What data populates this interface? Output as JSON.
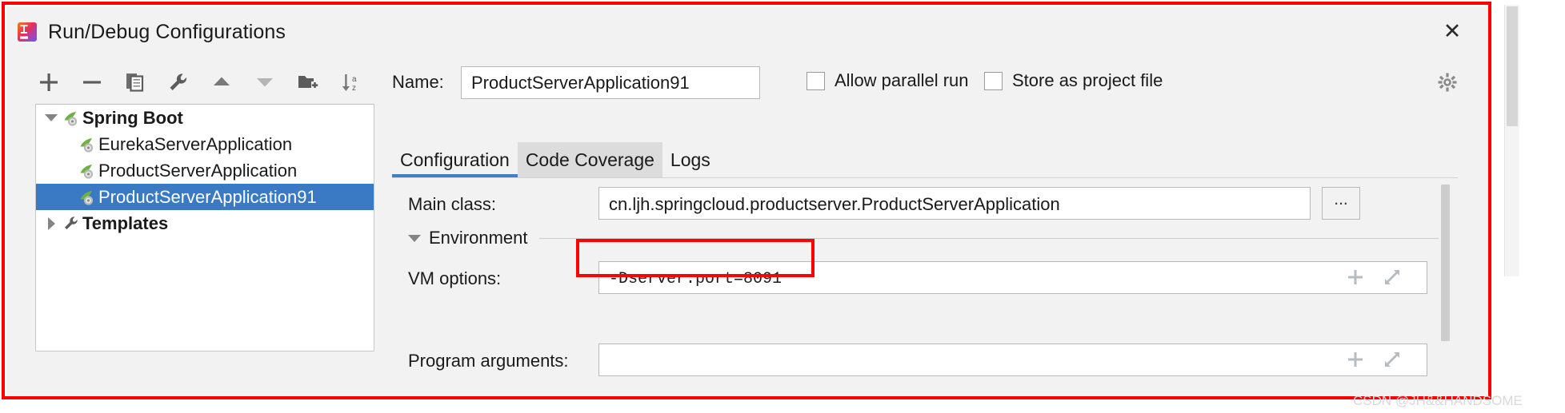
{
  "window": {
    "title": "Run/Debug Configurations",
    "app_icon": "intellij-idea-icon",
    "close_label": "✕"
  },
  "toolbar": {
    "buttons": [
      {
        "name": "add-configuration-button",
        "icon": "plus-icon",
        "label": "+"
      },
      {
        "name": "remove-configuration-button",
        "icon": "minus-icon",
        "label": "−"
      },
      {
        "name": "copy-configuration-button",
        "icon": "copy-icon",
        "label": "Copy"
      },
      {
        "name": "edit-templates-button",
        "icon": "wrench-icon",
        "label": "Edit Templates"
      },
      {
        "name": "move-up-button",
        "icon": "arrow-up-icon",
        "label": "Move Up"
      },
      {
        "name": "move-down-button",
        "icon": "arrow-down-icon",
        "label": "Move Down"
      },
      {
        "name": "move-into-folder-button",
        "icon": "folder-add-icon",
        "label": "New Folder"
      },
      {
        "name": "sort-configurations-button",
        "icon": "sort-alpha-icon",
        "label": "Sort"
      }
    ]
  },
  "tree": {
    "nodes": [
      {
        "label": "Spring Boot",
        "icon": "spring-boot-icon",
        "twisty": "expanded",
        "indent": 0,
        "bold": true,
        "selected": false
      },
      {
        "label": "EurekaServerApplication",
        "icon": "spring-boot-icon",
        "twisty": "none",
        "indent": 1,
        "bold": false,
        "selected": false
      },
      {
        "label": "ProductServerApplication",
        "icon": "spring-boot-icon",
        "twisty": "none",
        "indent": 1,
        "bold": false,
        "selected": false
      },
      {
        "label": "ProductServerApplication91",
        "icon": "spring-boot-icon",
        "twisty": "none",
        "indent": 1,
        "bold": false,
        "selected": true
      },
      {
        "label": "Templates",
        "icon": "wrench-icon",
        "twisty": "collapsed",
        "indent": 0,
        "bold": true,
        "selected": false
      }
    ],
    "selection_color": "#3a79c4"
  },
  "form": {
    "name_label": "Name:",
    "name_value": "ProductServerApplication91",
    "allow_parallel_run": {
      "label": "Allow parallel run",
      "checked": false
    },
    "store_as_project_file": {
      "label": "Store as project file",
      "checked": false
    },
    "settings_gear_icon": "gear-icon"
  },
  "tabs": {
    "items": [
      {
        "label": "Configuration",
        "active": true,
        "hovered": false
      },
      {
        "label": "Code Coverage",
        "active": false,
        "hovered": true
      },
      {
        "label": "Logs",
        "active": false,
        "hovered": false
      }
    ],
    "active_underline_color": "#3f7fc6"
  },
  "configuration": {
    "main_class": {
      "label": "Main class:",
      "value": "cn.ljh.springcloud.productserver.ProductServerApplication",
      "browse_label": "..."
    },
    "environment_section": {
      "title": "Environment",
      "expanded": true
    },
    "vm_options": {
      "label": "VM options:",
      "value": "-Dserver.port=8091",
      "add_icon": "plus-icon",
      "expand_icon": "expand-diagonal-icon",
      "annotation_color": "#ff0000"
    },
    "program_arguments": {
      "label": "Program arguments:",
      "value": ""
    }
  },
  "watermark": {
    "text": "CSDN @JH&&HANDSOME"
  }
}
